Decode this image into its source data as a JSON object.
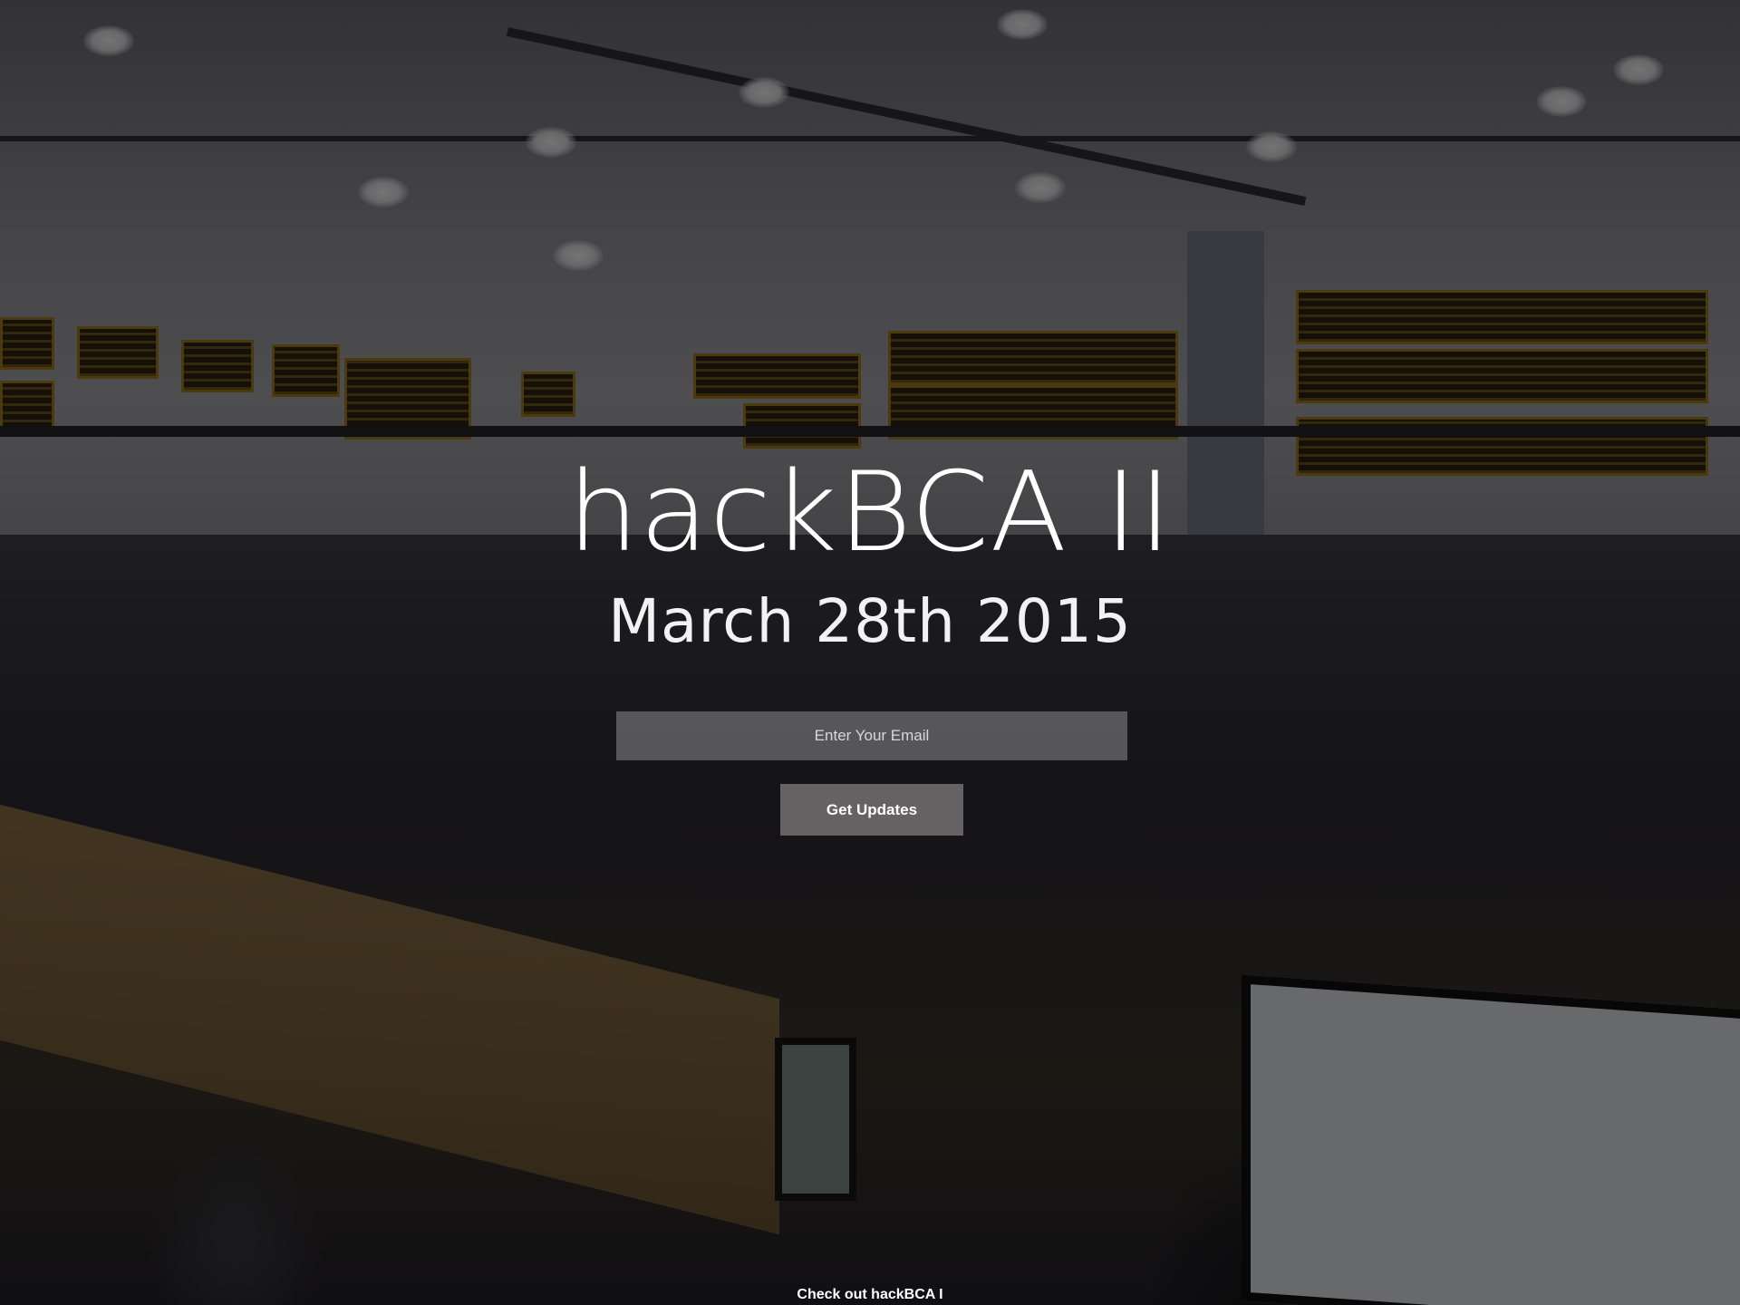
{
  "hero": {
    "title": "hackBCA II",
    "date": "March 28th 2015",
    "background": "event-photo"
  },
  "signup": {
    "email_placeholder": "Enter Your Email",
    "email_value": "",
    "button_label": "Get Updates"
  },
  "footer": {
    "link_label": "Check out hackBCA I"
  },
  "colors": {
    "overlay": "#000000",
    "text": "#ffffff",
    "input_bg": "#69696c",
    "button_bg": "#6e686a"
  }
}
